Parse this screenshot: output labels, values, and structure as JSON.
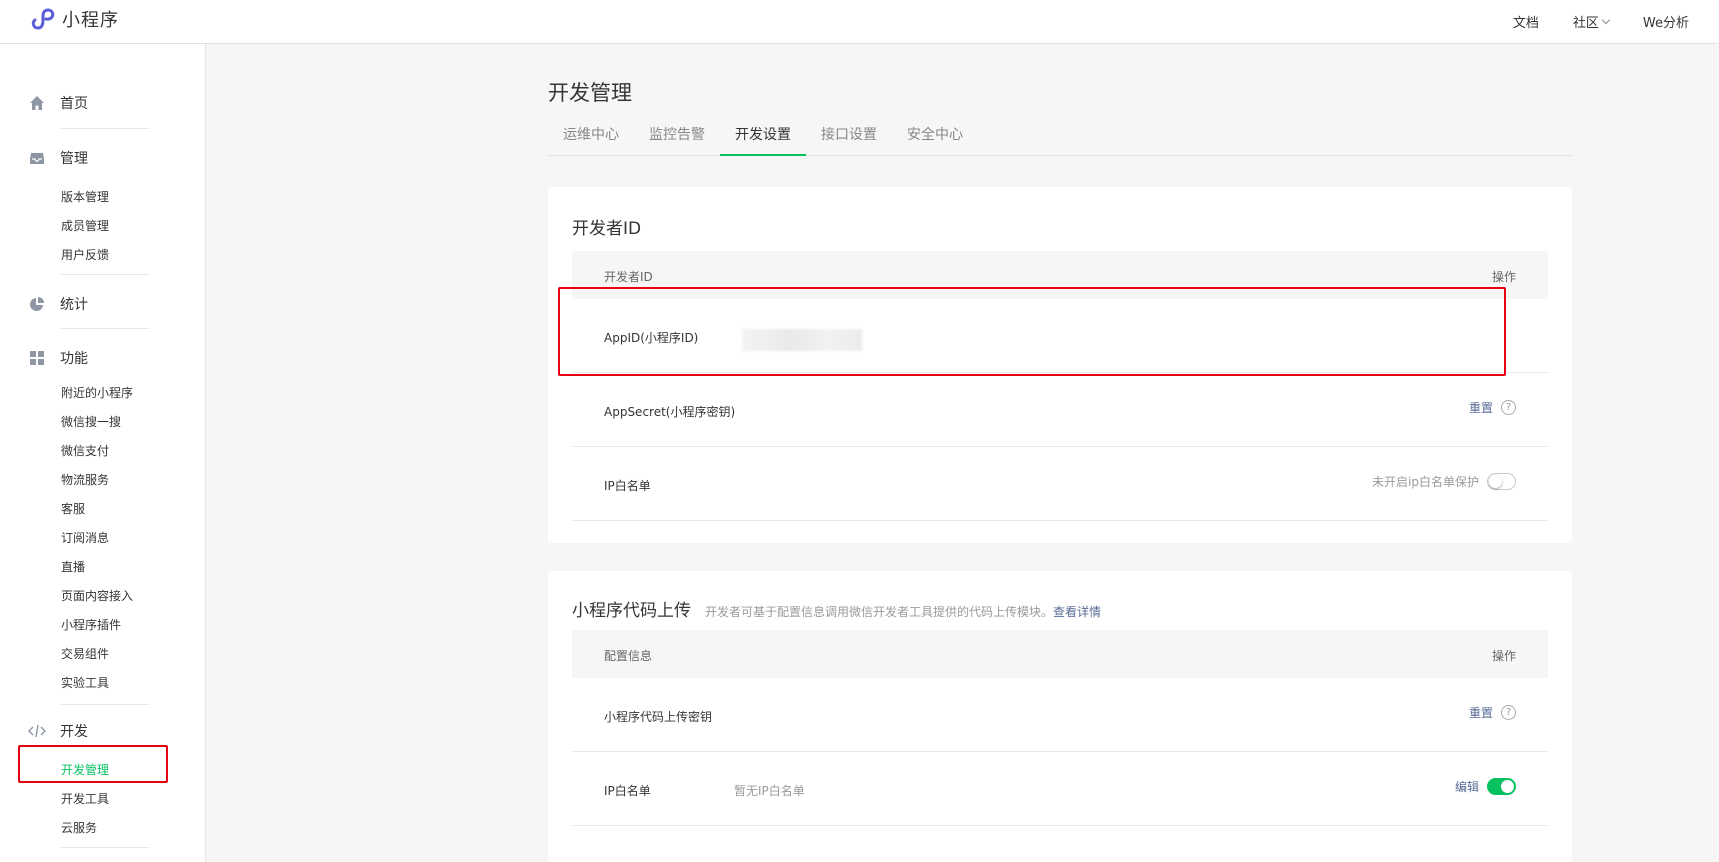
{
  "header": {
    "logo_text": "小程序",
    "nav": [
      "文档",
      "社区",
      "We分析"
    ]
  },
  "sidebar": {
    "groups": [
      {
        "label": "首页",
        "icon": "home-icon",
        "items": []
      },
      {
        "label": "管理",
        "icon": "inbox-icon",
        "items": [
          "版本管理",
          "成员管理",
          "用户反馈"
        ]
      },
      {
        "label": "统计",
        "icon": "pie-chart-icon",
        "items": []
      },
      {
        "label": "功能",
        "icon": "grid-icon",
        "items": [
          "附近的小程序",
          "微信搜一搜",
          "微信支付",
          "物流服务",
          "客服",
          "订阅消息",
          "直播",
          "页面内容接入",
          "小程序插件",
          "交易组件",
          "实验工具"
        ]
      },
      {
        "label": "开发",
        "icon": "code-icon",
        "items": [
          "开发管理",
          "开发工具",
          "云服务"
        ]
      }
    ],
    "active_item": "开发管理"
  },
  "main": {
    "title": "开发管理",
    "tabs": [
      "运维中心",
      "监控告警",
      "开发设置",
      "接口设置",
      "安全中心"
    ],
    "active_tab": "开发设置",
    "developer_id_card": {
      "title": "开发者ID",
      "header_left": "开发者ID",
      "header_right": "操作",
      "rows": [
        {
          "key": "AppID(小程序ID)"
        },
        {
          "key": "AppSecret(小程序密钥)",
          "action": "重置"
        },
        {
          "key": "IP白名单",
          "status": "未开启ip白名单保护"
        }
      ]
    },
    "upload_card": {
      "title": "小程序代码上传",
      "desc": "开发者可基于配置信息调用微信开发者工具提供的代码上传模块。",
      "desc_link": "查看详情",
      "header_left": "配置信息",
      "header_right": "操作",
      "rows": [
        {
          "key": "小程序代码上传密钥",
          "action": "重置"
        },
        {
          "key": "IP白名单",
          "value": "暂无IP白名单",
          "action": "编辑"
        }
      ]
    }
  },
  "colors": {
    "accent": "#07c160",
    "link": "#576b95",
    "highlight": "#e60012"
  }
}
